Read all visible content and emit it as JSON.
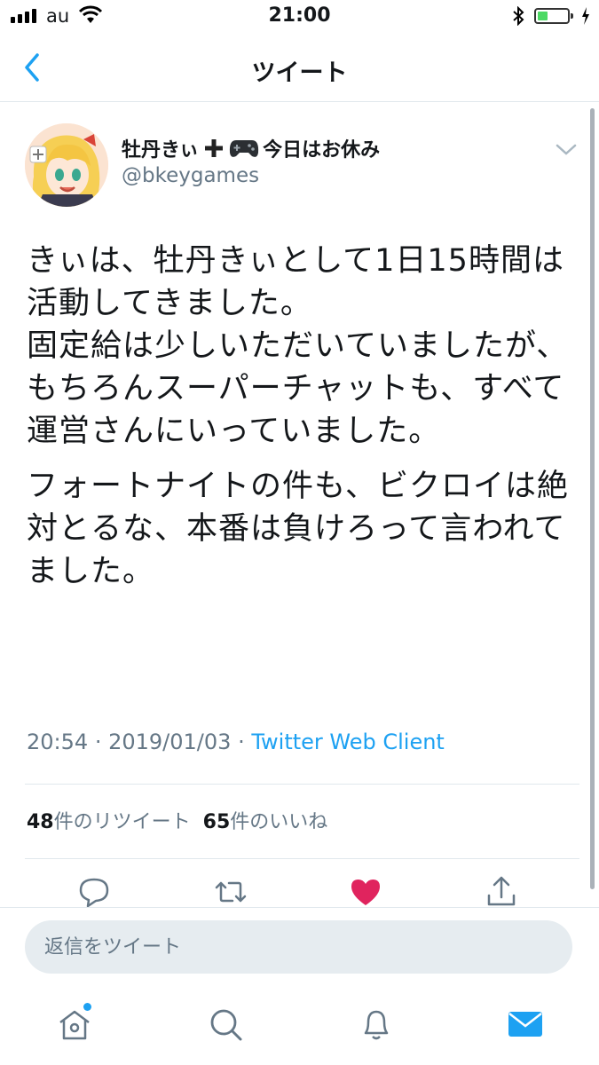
{
  "status_bar": {
    "carrier": "au",
    "time": "21:00",
    "battery_level": 0.35
  },
  "nav": {
    "title": "ツイート"
  },
  "tweet": {
    "display_name_part1": "牡丹きぃ",
    "display_name_part2": "今日はお休み",
    "handle": "@bkeygames",
    "paragraphs": [
      "きぃは、牡丹きぃとして1日15時間は活動してきました。\n固定給は少しいただいていましたが、\nもちろんスーパーチャットも、すべて運営さんにいっていました。",
      "フォートナイトの件も、ビクロイは絶対とるな、本番は負けろって言われてました。"
    ],
    "time": "20:54",
    "date": "2019/01/03",
    "separator": "·",
    "source": "Twitter Web Client",
    "retweet_count": "48",
    "retweet_label": "件のリツイート",
    "like_count": "65",
    "like_label": "件のいいね",
    "liked": true
  },
  "reply": {
    "placeholder": "返信をツイート"
  },
  "icons": {
    "back": "chevron-left-icon",
    "caret": "chevron-down-icon",
    "reply": "reply-icon",
    "retweet": "retweet-icon",
    "like": "heart-icon",
    "share": "share-icon",
    "home": "home-icon",
    "search": "search-icon",
    "notifications": "bell-icon",
    "messages": "mail-icon"
  },
  "colors": {
    "accent": "#1da1f2",
    "like": "#e0245e",
    "muted": "#657786",
    "text": "#14171a"
  }
}
